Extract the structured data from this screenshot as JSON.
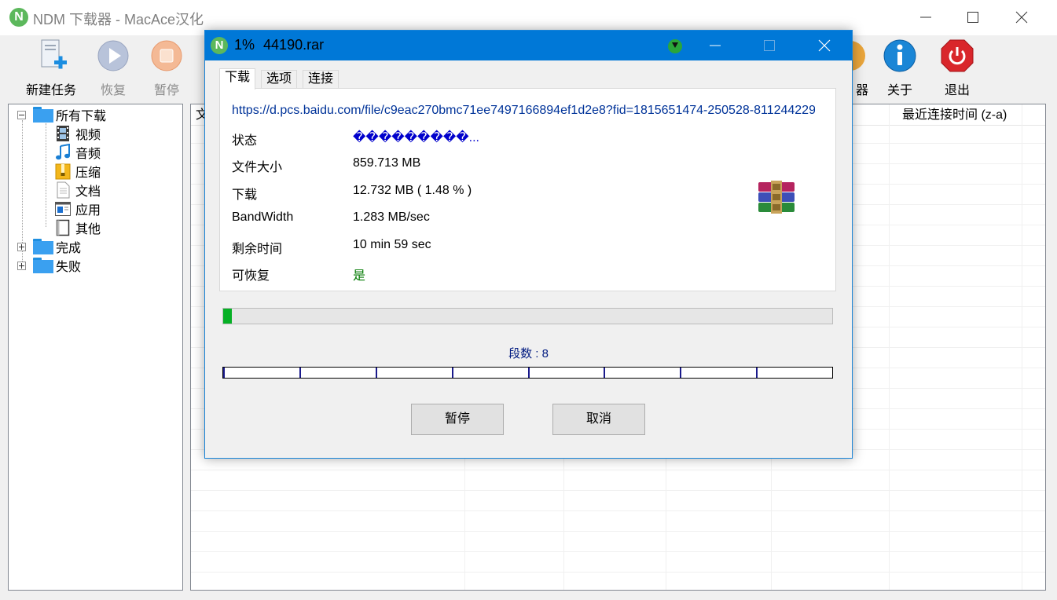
{
  "main_window": {
    "title": "NDM 下载器 - MacAce汉化",
    "logo_letter": "N"
  },
  "toolbar": {
    "new_task": "新建任务",
    "resume": "恢复",
    "pause": "暂停",
    "partial_label": "器",
    "about": "关于",
    "exit": "退出"
  },
  "tree": {
    "root": "所有下载",
    "children": [
      "视频",
      "音频",
      "压缩",
      "文档",
      "应用",
      "其他"
    ],
    "completed": "完成",
    "failed": "失败"
  },
  "list": {
    "first_col_partial": "文",
    "last_conn_header": "最近连接时间 (z-a)"
  },
  "dialog": {
    "percent": "1%",
    "filename": "44190.rar",
    "logo_letter": "N",
    "tabs": [
      "下载",
      "选项",
      "连接"
    ],
    "url": "https://d.pcs.baidu.com/file/c9eac270bmc71ee7497166894ef1d2e8?fid=1815651474-250528-811244229",
    "fields": {
      "status_label": "状态",
      "status_value": "���������...",
      "size_label": "文件大小",
      "size_value": "859.713 MB",
      "downloaded_label": "下载",
      "downloaded_value": "12.732 MB ( 1.48 % )",
      "bandwidth_label": "BandWidth",
      "bandwidth_value": "1.283 MB/sec",
      "remaining_label": "剩余时间",
      "remaining_value": "10 min  59 sec",
      "resumable_label": "可恢复",
      "resumable_value": "是"
    },
    "progress_fraction": 0.0148,
    "segments_label": "段数 : 8",
    "segments": 8,
    "pause_button": "暂停",
    "cancel_button": "取消"
  },
  "colors": {
    "accent": "#0078d7",
    "progress": "#06b025",
    "link": "#003399",
    "status": "#0000cc",
    "resumable": "#007a00"
  }
}
